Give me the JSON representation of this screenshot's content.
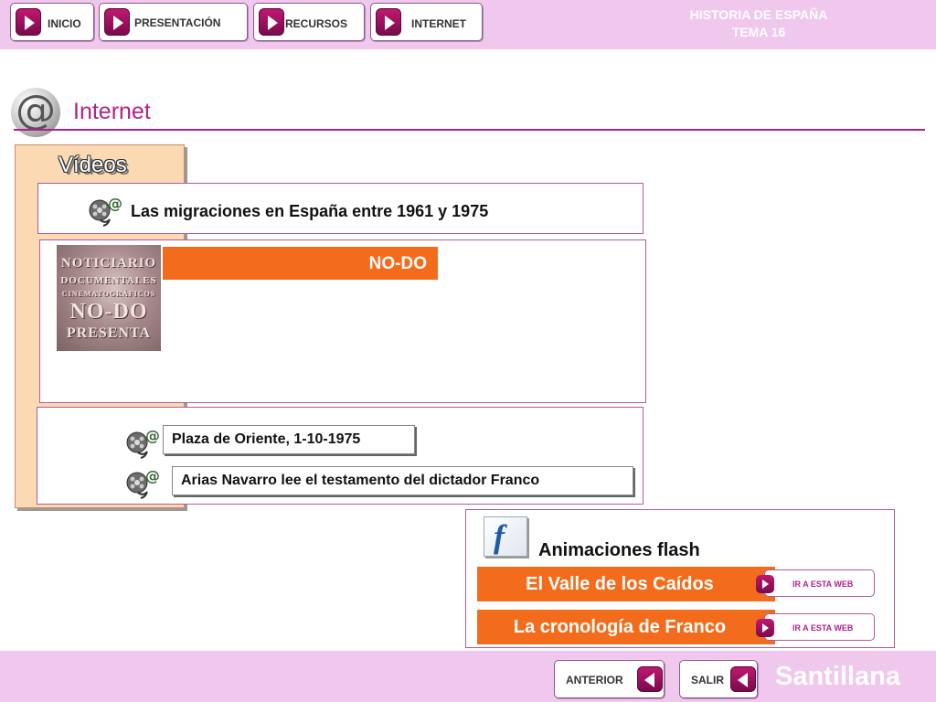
{
  "header": {
    "nav": [
      {
        "label": "INICIO"
      },
      {
        "label": "PRESENTACIÓN"
      },
      {
        "label": "RECURSOS"
      },
      {
        "label": "INTERNET"
      }
    ],
    "title_line1": "HISTORIA DE ESPAÑA",
    "title_line2": "TEMA 16"
  },
  "section": {
    "icon": "at-sign-icon",
    "title": "Internet"
  },
  "videos": {
    "heading": "Vídeos",
    "main_video_title": "Las migraciones en España entre 1961 y 1975",
    "nodo": {
      "image_lines": [
        "NOTICIARIO",
        "DOCUMENTALES",
        "CINEMATOGRÁFICOS",
        "NO-DO",
        "PRESENTA"
      ],
      "label": "NO-DO"
    },
    "links": [
      {
        "label": "Plaza de Oriente, 1-10-1975"
      },
      {
        "label": "Arias Navarro lee el testamento del dictador Franco"
      }
    ]
  },
  "flash": {
    "icon": "flash-icon",
    "icon_glyph": "f",
    "title": "Animaciones flash",
    "items": [
      {
        "label": "El Valle de los Caídos",
        "go_label": "IR A ESTA WEB"
      },
      {
        "label": "La cronología de Franco",
        "go_label": "IR A ESTA WEB"
      }
    ]
  },
  "footer": {
    "back_label": "ANTERIOR",
    "exit_label": "SALIR",
    "brand": "Santillana"
  },
  "colors": {
    "bar_pink": "#f0c8ee",
    "accent_magenta": "#b0228a",
    "orange": "#f36c1c",
    "peach": "#fbd9b3"
  }
}
